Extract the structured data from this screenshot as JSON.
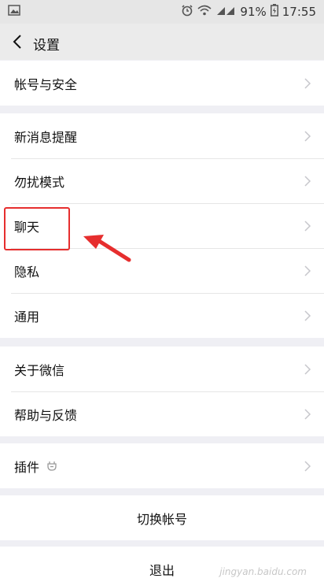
{
  "status_bar": {
    "battery": "91%",
    "time": "17:55"
  },
  "header": {
    "title": "设置"
  },
  "groups": {
    "account": [
      "帐号与安全"
    ],
    "main": [
      "新消息提醒",
      "勿扰模式",
      "聊天",
      "隐私",
      "通用"
    ],
    "about": [
      "关于微信",
      "帮助与反馈"
    ],
    "plugins": [
      "插件"
    ]
  },
  "actions": {
    "switch_account": "切换帐号",
    "logout": "退出"
  },
  "annotation": {
    "highlighted_item": "聊天",
    "color": "#e62e2e"
  },
  "watermark": {
    "text": "jingyan.baidu.com"
  }
}
